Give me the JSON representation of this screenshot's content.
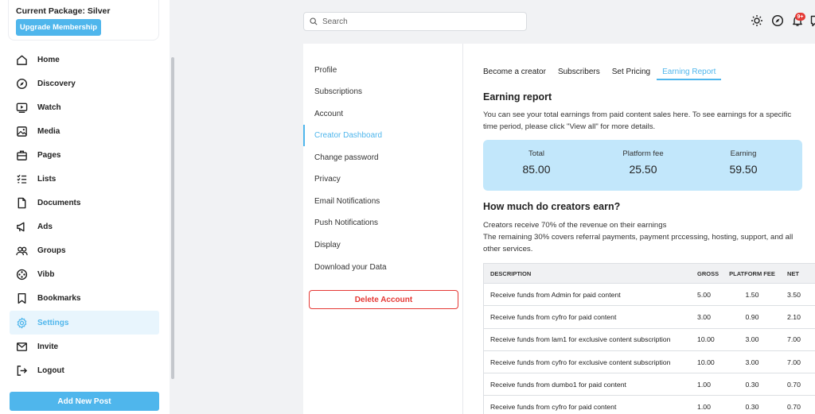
{
  "package": {
    "title": "Current Package: Silver",
    "upgrade_label": "Upgrade Membership"
  },
  "sidebar": {
    "items": [
      {
        "label": "Home",
        "icon": "home-icon"
      },
      {
        "label": "Discovery",
        "icon": "compass-icon"
      },
      {
        "label": "Watch",
        "icon": "play-icon"
      },
      {
        "label": "Media",
        "icon": "image-icon"
      },
      {
        "label": "Pages",
        "icon": "briefcase-icon"
      },
      {
        "label": "Lists",
        "icon": "checklist-icon"
      },
      {
        "label": "Documents",
        "icon": "document-icon"
      },
      {
        "label": "Ads",
        "icon": "megaphone-icon"
      },
      {
        "label": "Groups",
        "icon": "users-icon"
      },
      {
        "label": "Vibb",
        "icon": "film-reel-icon"
      },
      {
        "label": "Bookmarks",
        "icon": "bookmark-icon"
      },
      {
        "label": "Settings",
        "icon": "gear-icon",
        "active": true
      },
      {
        "label": "Invite",
        "icon": "envelope-icon"
      },
      {
        "label": "Logout",
        "icon": "logout-icon"
      }
    ],
    "add_post_label": "Add New Post"
  },
  "search": {
    "placeholder": "Search"
  },
  "topbar": {
    "notification_badge": "9+"
  },
  "settings_nav": {
    "items": [
      "Profile",
      "Subscriptions",
      "Account",
      "Creator Dashboard",
      "Change password",
      "Privacy",
      "Email Notifications",
      "Push Notifications",
      "Display",
      "Download your Data"
    ],
    "active": "Creator Dashboard",
    "delete_label": "Delete Account"
  },
  "tabs": [
    "Become a creator",
    "Subscribers",
    "Set Pricing",
    "Earning Report"
  ],
  "active_tab": "Earning Report",
  "report": {
    "title": "Earning report",
    "description": "You can see your total earnings from paid content sales here. To see earnings for a specific time period, please click \"View all\" for more details.",
    "summary": [
      {
        "label": "Total",
        "value": "85.00"
      },
      {
        "label": "Platform fee",
        "value": "25.50"
      },
      {
        "label": "Earning",
        "value": "59.50"
      }
    ]
  },
  "creators": {
    "title": "How much do creators earn?",
    "line1": "Creators receive 70% of the revenue on their earnings",
    "line2": "The remaining 30% covers referral payments, payment prccessing, hosting, support, and all other services."
  },
  "table": {
    "headers": [
      "DESCRIPTION",
      "GROSS",
      "PLATFORM FEE",
      "NET"
    ],
    "rows": [
      [
        "Receive funds from Admin for paid content",
        "5.00",
        "1.50",
        "3.50"
      ],
      [
        "Receive funds from cyfro for paid content",
        "3.00",
        "0.90",
        "2.10"
      ],
      [
        "Receive funds from lam1 for exclusive content subscription",
        "10.00",
        "3.00",
        "7.00"
      ],
      [
        "Receive funds from cyfro for exclusive content subscription",
        "10.00",
        "3.00",
        "7.00"
      ],
      [
        "Receive funds from dumbo1 for paid content",
        "1.00",
        "0.30",
        "0.70"
      ],
      [
        "Receive funds from cyfro for paid content",
        "1.00",
        "0.30",
        "0.70"
      ]
    ]
  }
}
